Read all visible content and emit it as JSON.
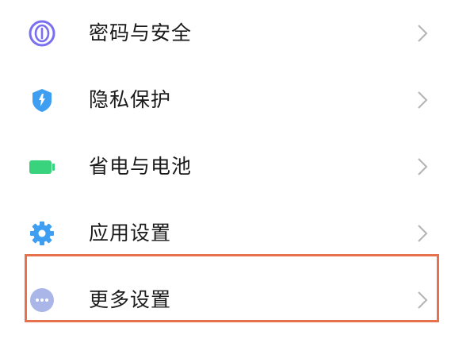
{
  "settings": {
    "items": [
      {
        "label": "密码与安全",
        "icon": "fingerprint-icon",
        "icon_color": "#7a6ff0"
      },
      {
        "label": "隐私保护",
        "icon": "shield-icon",
        "icon_color": "#3d9ef2"
      },
      {
        "label": "省电与电池",
        "icon": "battery-icon",
        "icon_color": "#38d37c"
      },
      {
        "label": "应用设置",
        "icon": "gear-icon",
        "icon_color": "#3d9ef2"
      },
      {
        "label": "更多设置",
        "icon": "more-dots-icon",
        "icon_color": "#aab6e8"
      }
    ],
    "highlighted_item": "更多设置",
    "highlight_color": "#e8714d"
  }
}
